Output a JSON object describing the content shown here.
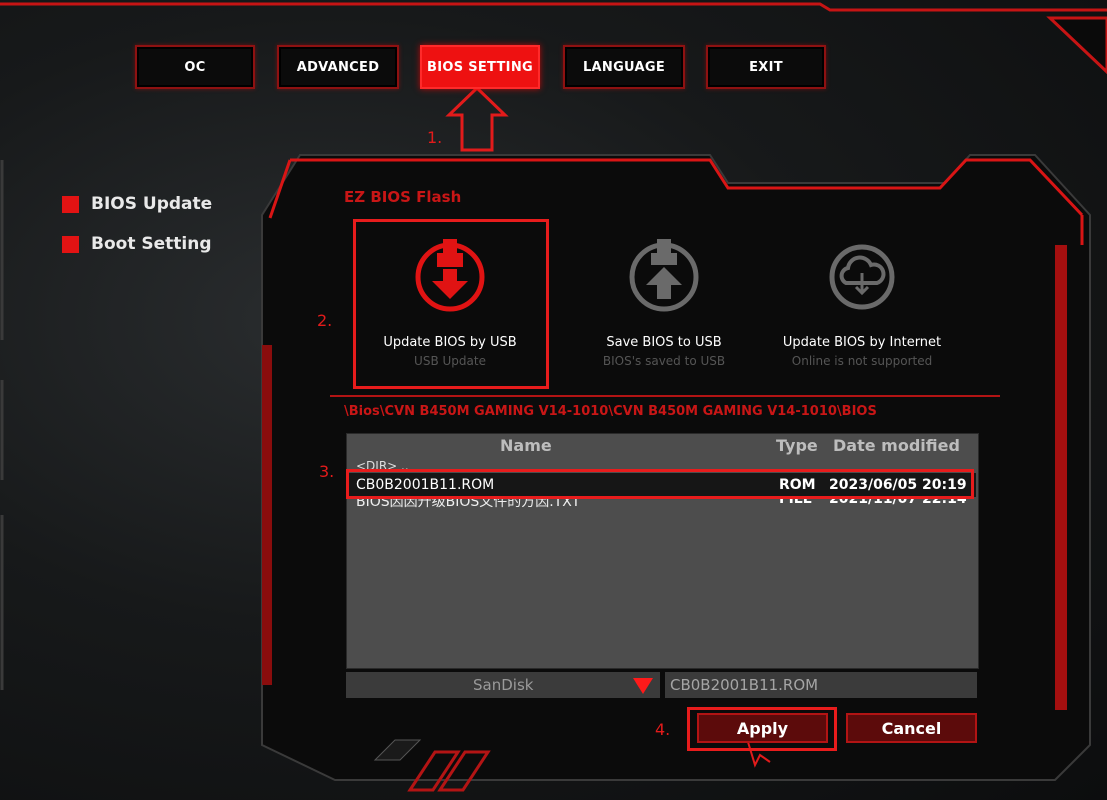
{
  "top_tabs": [
    {
      "label": "OC",
      "active": false
    },
    {
      "label": "ADVANCED",
      "active": false
    },
    {
      "label": "BIOS SETTING",
      "active": true
    },
    {
      "label": "LANGUAGE",
      "active": false
    },
    {
      "label": "EXIT",
      "active": false
    }
  ],
  "sidebar": {
    "items": [
      {
        "label": "BIOS Update"
      },
      {
        "label": "Boot Setting"
      }
    ]
  },
  "panel": {
    "title": "EZ BIOS Flash",
    "options": [
      {
        "label": "Update BIOS by USB",
        "sub": "USB Update",
        "icon": "usb-download-icon",
        "selected": true
      },
      {
        "label": "Save BIOS to USB",
        "sub": "BIOS's saved to USB",
        "icon": "usb-upload-icon",
        "selected": false
      },
      {
        "label": "Update BIOS by Internet",
        "sub": "Online is not supported",
        "icon": "cloud-download-icon",
        "selected": false
      }
    ],
    "path": "\\Bios\\CVN B450M GAMING V14-1010\\CVN B450M GAMING V14-1010\\BIOS",
    "table": {
      "headers": {
        "name": "Name",
        "type": "Type",
        "date": "Date modified"
      },
      "dir_row": "<DIR> ..",
      "rows": [
        {
          "name": "CB0B2001B11.ROM",
          "type": "ROM",
          "date": "2023/06/05 20:19",
          "selected": true
        },
        {
          "name": "BIOS因因升级BIOS文件的方因.TXT",
          "type": "FILE",
          "date": "2021/11/07 22:14",
          "selected": false
        }
      ]
    },
    "drive": {
      "value": "SanDisk"
    },
    "selected_file": "CB0B2001B11.ROM",
    "apply_label": "Apply",
    "cancel_label": "Cancel"
  },
  "annotations": {
    "step1": "1.",
    "step2": "2.",
    "step3": "3.",
    "step4": "4."
  },
  "colors": {
    "accent": "#e21313",
    "panel_bg": "#0c0c0c",
    "file_area": "#4d4d4d"
  }
}
